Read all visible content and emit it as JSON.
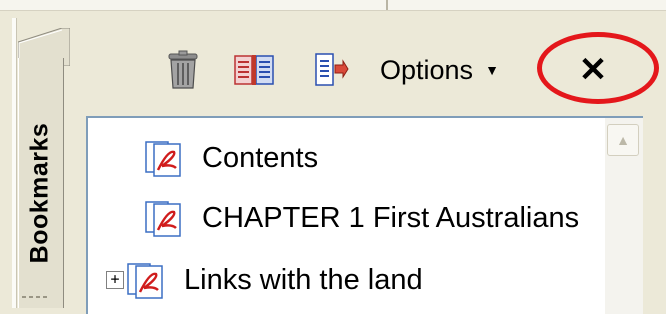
{
  "bookmarks_tab": {
    "label": "Bookmarks"
  },
  "toolbar": {
    "delete_icon": "trash-icon",
    "expand_icon": "expand-bookmark-icon",
    "new_icon": "new-bookmark-icon",
    "options_label": "Options",
    "options_caret": "▼",
    "close_label": "✕"
  },
  "annotation": {
    "ring_color": "#e4171b"
  },
  "bookmarks": [
    {
      "label": "Contents",
      "expandable": false
    },
    {
      "label": "CHAPTER 1 First Australians",
      "expandable": false
    },
    {
      "label": "Links with the land",
      "expandable": true,
      "expander": "+"
    }
  ],
  "scrollbar": {
    "up_arrow": "▲"
  }
}
